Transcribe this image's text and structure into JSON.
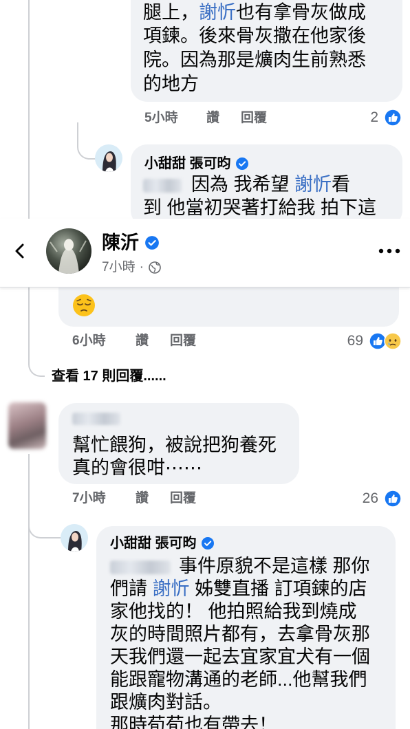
{
  "theme": {
    "bubble": "#f0f2f5",
    "link": "#3a6fc4",
    "meta": "#65676b",
    "brand_blue": "#1877f2",
    "text": "#050505"
  },
  "top_reply": {
    "lines": [
      [
        "腿上，",
        "謝忻",
        "也有拿骨灰做成"
      ],
      [
        "項鍊。後來骨灰撒在他家後"
      ],
      [
        "院。因為那是爌肉生前熟悉"
      ],
      [
        "的地方"
      ]
    ],
    "meta": {
      "time": "5小時",
      "like": "讚",
      "reply": "回覆",
      "reaction_count": "2",
      "reactions": [
        "like-icon"
      ]
    }
  },
  "reply_1": {
    "author": "小甜甜 張可昀",
    "verified_icon": "verified-badge-icon",
    "lines": [
      [
        "因為 我希望 ",
        "謝忻",
        "看"
      ],
      [
        "到 他當初哭著打給我 拍下這"
      ]
    ]
  },
  "header": {
    "back_icon": "chevron-left-icon",
    "author": "陳沂",
    "verified_icon": "verified-badge-icon",
    "time": "7小時",
    "separator": "·",
    "privacy_icon": "globe-icon",
    "more_icon": "more-horizontal-icon"
  },
  "post_comment": {
    "emoji": "pensive-face-emoji",
    "meta": {
      "time": "6小時",
      "like": "讚",
      "reply": "回覆",
      "reaction_count": "69",
      "reactions": [
        "like-icon",
        "sad-icon"
      ]
    }
  },
  "view_replies": "查看 17 則回覆......",
  "comment_2": {
    "lines": [
      "幫忙餵狗，被說把狗養死",
      "真的會很咁⋯⋯"
    ],
    "meta": {
      "time": "7小時",
      "like": "讚",
      "reply": "回覆",
      "reaction_count": "26",
      "reactions": [
        "like-icon"
      ]
    }
  },
  "reply_2": {
    "author": "小甜甜 張可昀",
    "verified_icon": "verified-badge-icon",
    "lines": [
      [
        "事件原貌不是這樣 那你"
      ],
      [
        "們請 ",
        "謝忻",
        " 姊雙直播 訂項鍊的店"
      ],
      [
        "家他找的！ 他拍照給我到燒成"
      ],
      [
        "灰的時間照片都有，去拿骨灰那"
      ],
      [
        "天我們還一起去宜家宜犬有一個"
      ],
      [
        "能跟寵物溝通的老師...他幫我們"
      ],
      [
        "跟爌肉對話。"
      ],
      [
        "那時荀荀也有帶去！"
      ]
    ]
  }
}
